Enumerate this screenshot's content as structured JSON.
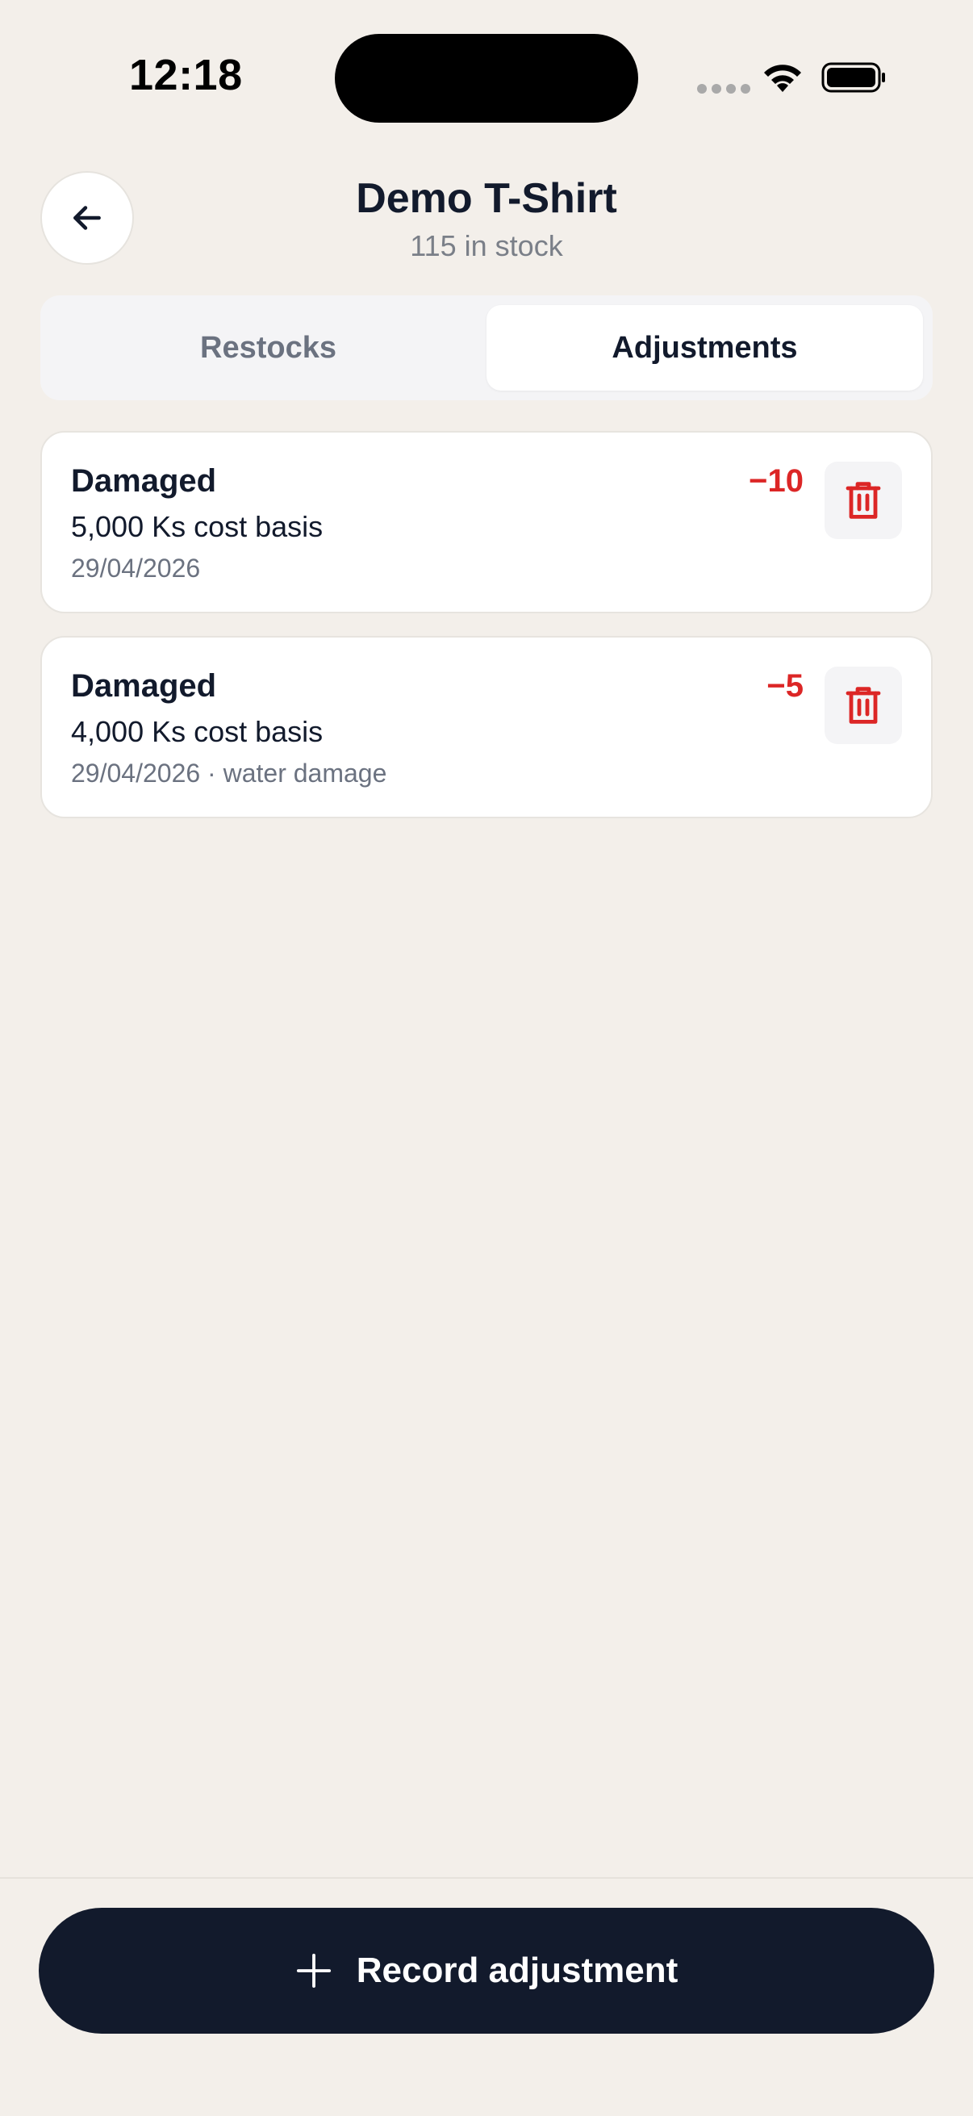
{
  "status_bar": {
    "time": "12:18"
  },
  "header": {
    "title": "Demo T-Shirt",
    "subtitle": "115 in stock",
    "back_icon": "arrow-left-icon"
  },
  "tabs": [
    {
      "label": "Restocks",
      "active": false
    },
    {
      "label": "Adjustments",
      "active": true
    }
  ],
  "adjustments": [
    {
      "reason": "Damaged",
      "cost": "5,000 Ks cost basis",
      "meta": "29/04/2026",
      "qty": "−10"
    },
    {
      "reason": "Damaged",
      "cost": "4,000 Ks cost basis",
      "meta": "29/04/2026 · water damage",
      "qty": "−5"
    }
  ],
  "footer": {
    "primary_label": "Record adjustment",
    "primary_icon": "plus-icon"
  },
  "colors": {
    "background": "#F3EFEA",
    "primary": "#121A2C",
    "danger": "#DC2626",
    "muted": "#6B7280"
  }
}
